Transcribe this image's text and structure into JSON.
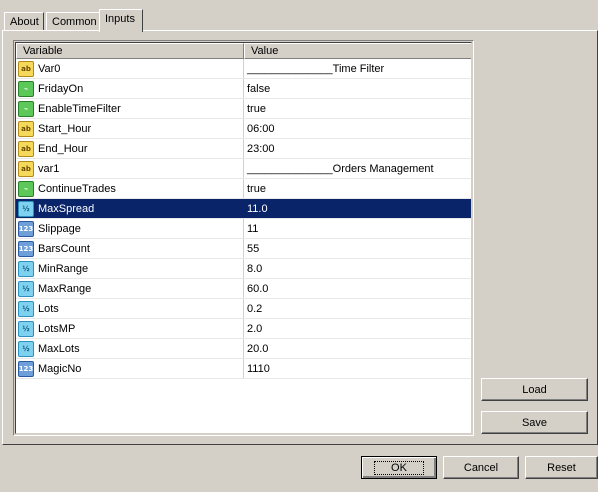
{
  "tabs": [
    "About",
    "Common",
    "Inputs"
  ],
  "table": {
    "headers": {
      "variable": "Variable",
      "value": "Value"
    },
    "rows": [
      {
        "name": "Var0",
        "value": "______________Time Filter",
        "type": "str"
      },
      {
        "name": "FridayOn",
        "value": "false",
        "type": "bool"
      },
      {
        "name": "EnableTimeFilter",
        "value": "true",
        "type": "bool"
      },
      {
        "name": "Start_Hour",
        "value": "06:00",
        "type": "str"
      },
      {
        "name": "End_Hour",
        "value": "23:00",
        "type": "str"
      },
      {
        "name": "var1",
        "value": "______________Orders Management",
        "type": "str"
      },
      {
        "name": "ContinueTrades",
        "value": "true",
        "type": "bool"
      },
      {
        "name": "MaxSpread",
        "value": "11.0",
        "type": "dbl"
      },
      {
        "name": "Slippage",
        "value": "11",
        "type": "int"
      },
      {
        "name": "BarsCount",
        "value": "55",
        "type": "int"
      },
      {
        "name": "MinRange",
        "value": "8.0",
        "type": "dbl"
      },
      {
        "name": "MaxRange",
        "value": "60.0",
        "type": "dbl"
      },
      {
        "name": "Lots",
        "value": "0.2",
        "type": "dbl"
      },
      {
        "name": "LotsMP",
        "value": "2.0",
        "type": "dbl"
      },
      {
        "name": "MaxLots",
        "value": "20.0",
        "type": "dbl"
      },
      {
        "name": "MagicNo",
        "value": "1110",
        "type": "int"
      }
    ],
    "selected_row": "MaxSpread"
  },
  "icons": {
    "str": {
      "glyph": "ab",
      "name": "string-type-icon"
    },
    "bool": {
      "glyph": "⌁",
      "name": "boolean-type-icon"
    },
    "dbl": {
      "glyph": "½",
      "name": "double-type-icon"
    },
    "int": {
      "glyph": "123",
      "name": "integer-type-icon"
    }
  },
  "side_buttons": {
    "load": "Load",
    "save": "Save"
  },
  "dialog_buttons": {
    "ok": "OK",
    "cancel": "Cancel",
    "reset": "Reset"
  },
  "colors": {
    "selection": "#0a246a",
    "face": "#d4d0c8"
  }
}
